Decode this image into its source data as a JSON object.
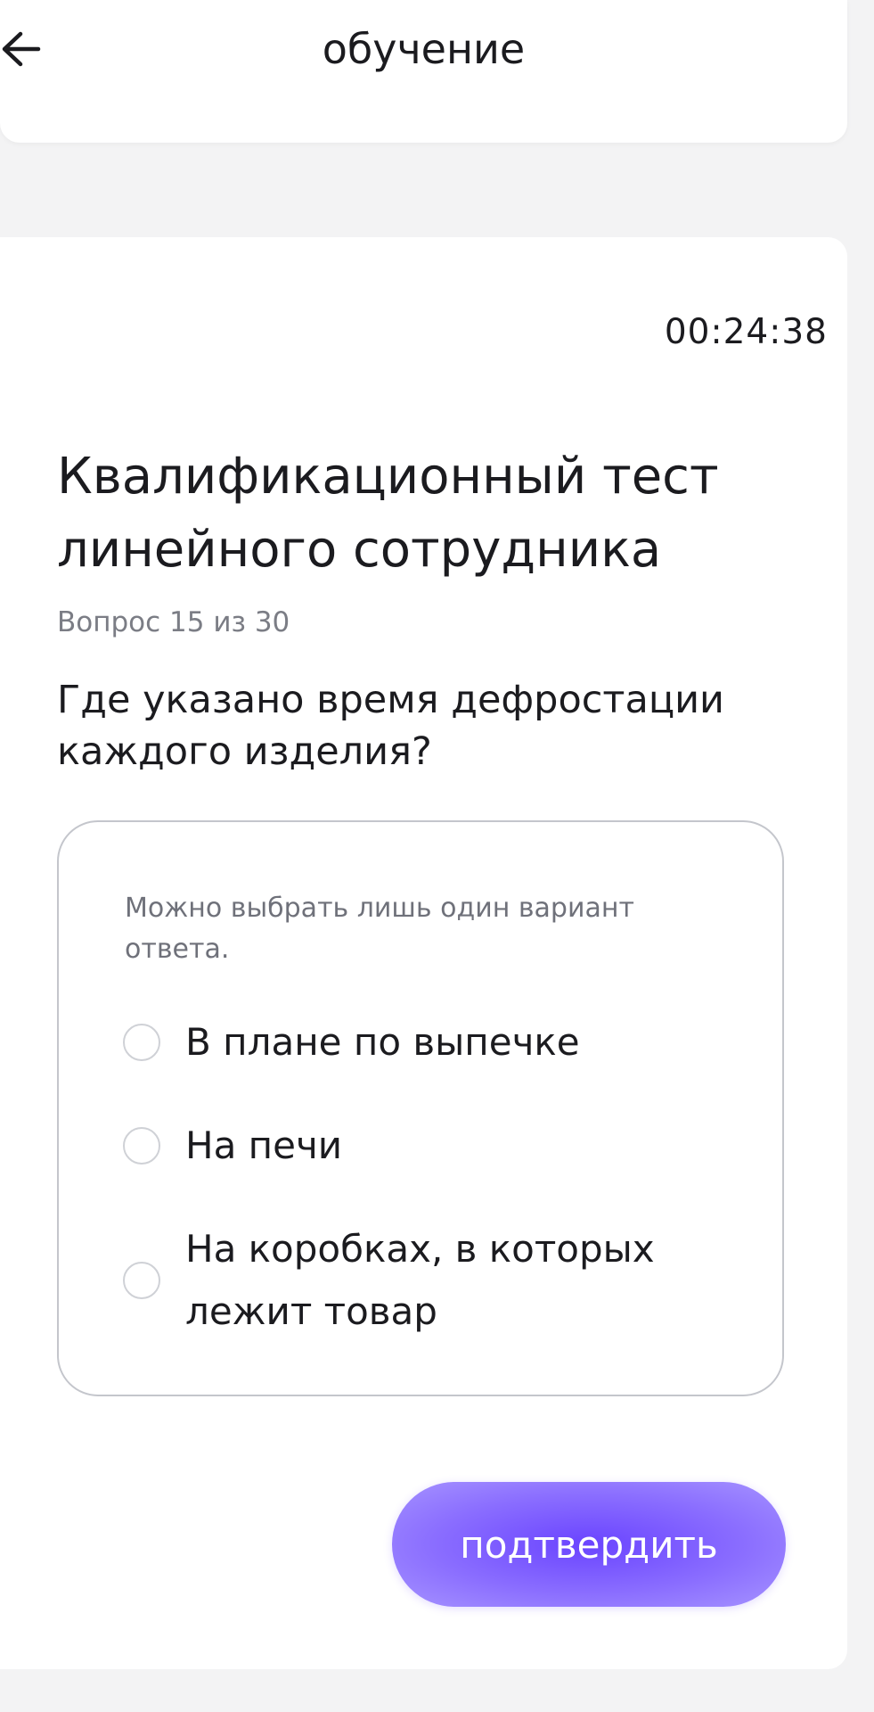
{
  "header": {
    "back_icon": "arrow-left-icon",
    "title": "обучение"
  },
  "quiz": {
    "timer": "00:24:38",
    "test_title": "Квалификационный тест линейного сотрудника",
    "progress": "Вопрос 15 из 30",
    "question": "Где указано время дефростации каждого изделия?",
    "hint": "Можно выбрать лишь один вариант ответа.",
    "options": [
      {
        "label": "В плане по выпечке",
        "selected": false
      },
      {
        "label": "На печи",
        "selected": false
      },
      {
        "label": "На коробках, в которых лежит товар",
        "selected": false
      }
    ],
    "confirm_label": "подтвердить"
  },
  "colors": {
    "accent": "#6a44ff",
    "background": "#f3f3f4",
    "card": "#ffffff",
    "muted_text": "#7b7d85",
    "border": "#c4c6cc"
  }
}
